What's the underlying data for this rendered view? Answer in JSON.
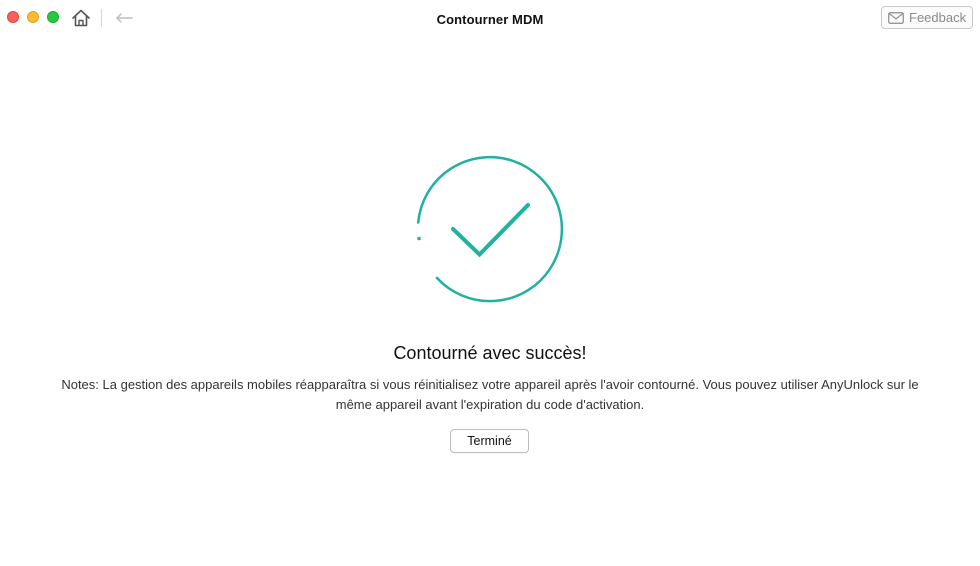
{
  "window": {
    "title": "Contourner MDM",
    "controls": {
      "close_icon": "close-icon",
      "minimize_icon": "minimize-icon",
      "maximize_icon": "maximize-icon"
    }
  },
  "toolbar": {
    "home_icon": "home-icon",
    "back_icon": "back-arrow-icon",
    "feedback_label": "Feedback",
    "feedback_icon": "mail-icon"
  },
  "result": {
    "icon": "checkmark-circle-icon",
    "heading": "Contourné avec succès!",
    "notes": "Notes: La gestion des appareils mobiles réapparaîtra si vous réinitialisez votre appareil après l'avoir contourné. Vous pouvez utiliser AnyUnlock sur le même appareil avant l'expiration du code d'activation.",
    "done_label": "Terminé"
  },
  "colors": {
    "accent": "#1fb29f",
    "traffic_close": "#fc5f57",
    "traffic_minimize": "#fdbc2e",
    "traffic_maximize": "#28c840"
  }
}
